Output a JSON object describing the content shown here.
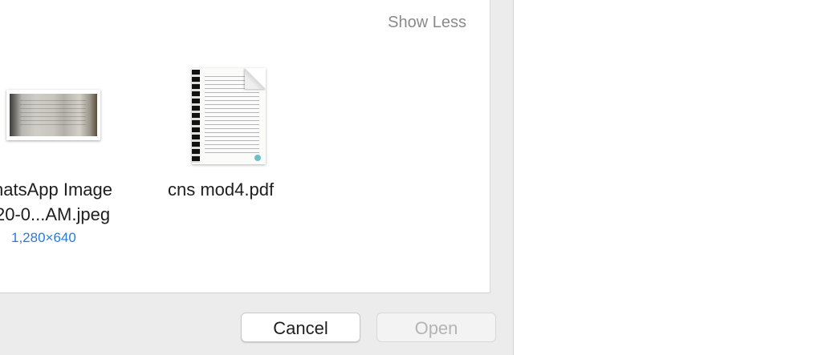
{
  "browser": {
    "toggle_label": "Show Less",
    "files": [
      {
        "name_line1": "hatsApp Image",
        "name_line2": "20-0...AM.jpeg",
        "dimensions": "1,280×640",
        "icon": "image-thumbnail"
      },
      {
        "name_line1": "cns mod4.pdf",
        "icon": "pdf-thumbnail"
      }
    ]
  },
  "buttons": {
    "cancel_label": "Cancel",
    "open_label": "Open"
  },
  "colors": {
    "accent_blue": "#2a7bd6",
    "dialog_bg": "#ececec"
  }
}
